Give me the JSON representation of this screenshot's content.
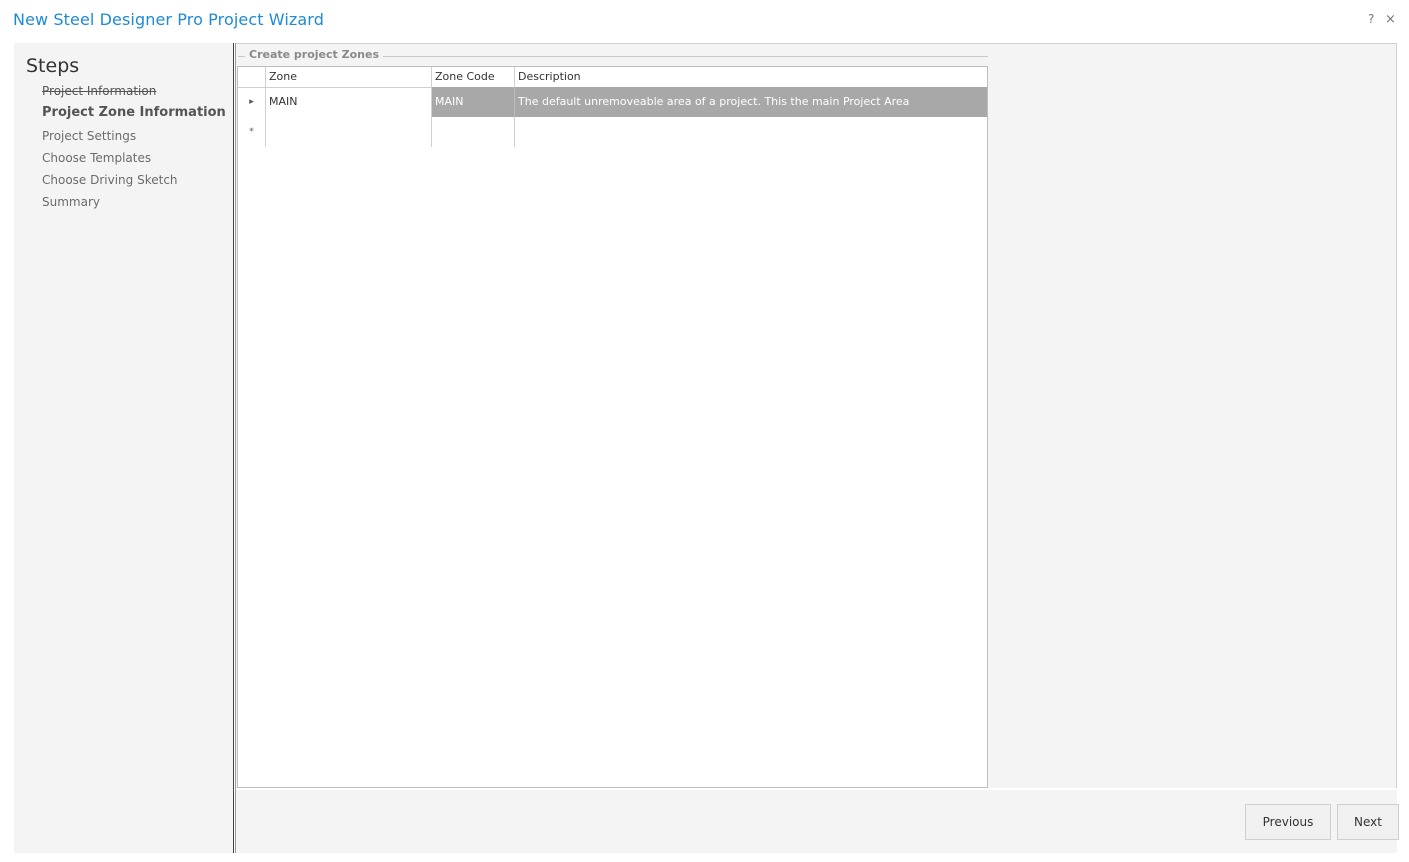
{
  "window": {
    "title": "New Steel Designer Pro Project Wizard",
    "help_label": "?",
    "close_label": "×"
  },
  "sidebar": {
    "title": "Steps",
    "steps": [
      {
        "label": "Project Information",
        "state": "done"
      },
      {
        "label": "Project Zone Information",
        "state": "current"
      },
      {
        "label": "Project Settings",
        "state": "pending"
      },
      {
        "label": "Choose Templates",
        "state": "pending"
      },
      {
        "label": "Choose Driving Sketch",
        "state": "pending"
      },
      {
        "label": "Summary",
        "state": "pending"
      }
    ]
  },
  "zones_group": {
    "legend": "Create project Zones",
    "columns": [
      "Zone",
      "Zone Code",
      "Description"
    ],
    "rows": [
      {
        "indicator": "▸",
        "zone": "MAIN",
        "zone_code": "MAIN",
        "description": "The default unremoveable area of a project. This the main Project Area"
      }
    ],
    "new_row_indicator": "*"
  },
  "footer": {
    "previous_label": "Previous",
    "next_label": "Next"
  },
  "colors": {
    "title": "#1f8ad4",
    "selection": "#a8a8a8",
    "panel": "#f4f4f4"
  }
}
